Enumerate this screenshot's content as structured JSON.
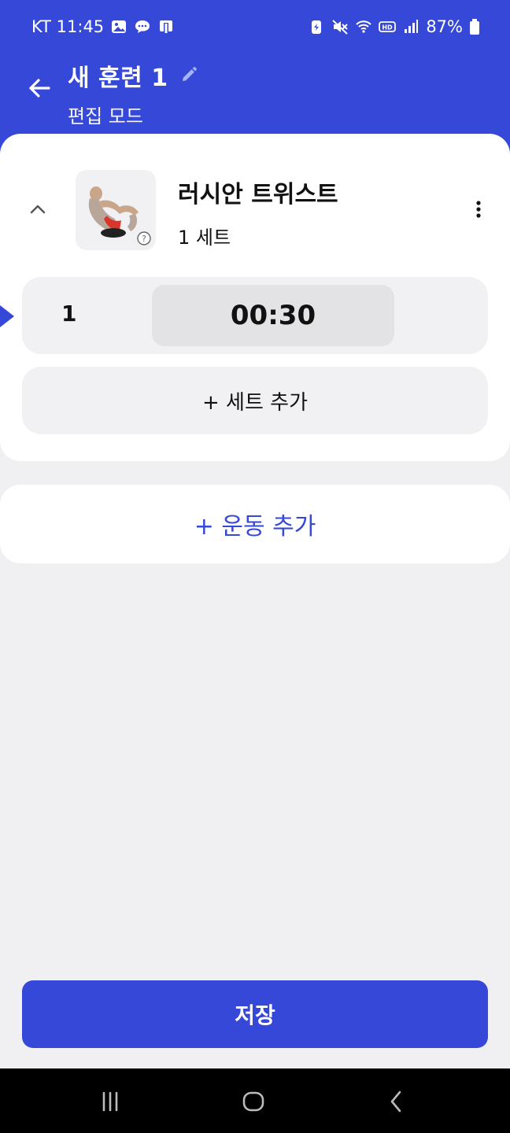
{
  "status_bar": {
    "carrier_time": "KT 11:45",
    "battery_percent": "87%",
    "left_icons": [
      "gallery-icon",
      "chat-icon",
      "app-icon"
    ],
    "right_icons": [
      "battery-saver-icon",
      "mute-icon",
      "wifi-icon",
      "hd-icon",
      "signal-icon",
      "battery-icon"
    ]
  },
  "header": {
    "title": "새 훈련 1",
    "subtitle": "편집 모드",
    "background_color": "#3648d8"
  },
  "exercise": {
    "name": "러시안 트위스트",
    "set_count_label": "1 세트",
    "thumbnail_icon": "russian-twist-exercise-image",
    "sets": [
      {
        "number": "1",
        "time": "00:30"
      }
    ],
    "add_set_label": "+ 세트 추가"
  },
  "add_exercise_label": "+ 운동 추가",
  "save_label": "저장",
  "colors": {
    "accent": "#3648d8",
    "background": "#f0f0f2",
    "card": "#ffffff"
  }
}
